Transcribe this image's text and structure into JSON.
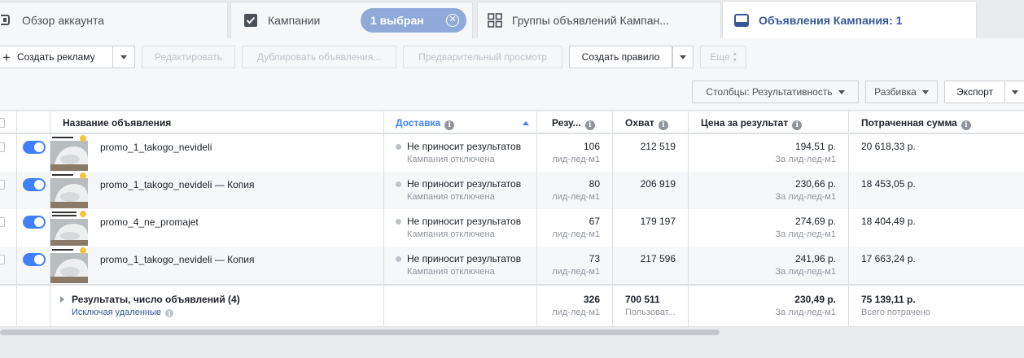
{
  "tabs": {
    "account_overview": "Обзор аккаунта",
    "campaigns": "Кампании",
    "selected_badge": "1 выбран",
    "ad_sets": "Группы объявлений Кампан...",
    "ads": "Объявления Кампания: 1"
  },
  "toolbar": {
    "create_ad": "Создать рекламу",
    "edit": "Редактировать",
    "duplicate": "Дублировать объявления...",
    "preview": "Предварительный просмотр",
    "create_rule": "Создать правило",
    "more": "Еще",
    "columns": "Столбцы: Результативность",
    "breakdown": "Разбивка",
    "export": "Экспорт"
  },
  "table": {
    "headers": {
      "name": "Название объявления",
      "delivery": "Доставка",
      "results": "Резу...",
      "reach": "Охват",
      "cost_per_result": "Цена за результат",
      "amount_spent": "Потраченная сумма"
    },
    "rows": [
      {
        "name": "promo_1_takogo_nevideli",
        "delivery": "Не приносит результатов",
        "delivery_sub": "Кампания отключена",
        "results": "106",
        "results_sub": "лид-лед-м1",
        "reach": "212 519",
        "cost": "194,51 р.",
        "cost_sub": "За лид-лед-м1",
        "spent": "20 618,33 р."
      },
      {
        "name": "promo_1_takogo_nevideli — Копия",
        "delivery": "Не приносит результатов",
        "delivery_sub": "Кампания отключена",
        "results": "80",
        "results_sub": "лид-лед-м1",
        "reach": "206 919",
        "cost": "230,66 р.",
        "cost_sub": "За лид-лед-м1",
        "spent": "18 453,05 р."
      },
      {
        "name": "promo_4_ne_promajet",
        "delivery": "Не приносит результатов",
        "delivery_sub": "Кампания отключена",
        "results": "67",
        "results_sub": "лид-лед-м1",
        "reach": "179 197",
        "cost": "274,69 р.",
        "cost_sub": "За лид-лед-м1",
        "spent": "18 404,49 р."
      },
      {
        "name": "promo_1_takogo_nevideli — Копия",
        "delivery": "Не приносит результатов",
        "delivery_sub": "Кампания отключена",
        "results": "73",
        "results_sub": "лид-лед-м1",
        "reach": "217 596",
        "cost": "241,96 р.",
        "cost_sub": "За лид-лед-м1",
        "spent": "17 663,24 р."
      }
    ],
    "totals": {
      "label": "Результаты, число объявлений (4)",
      "sublabel": "Исключая удаленные",
      "results": "326",
      "results_sub": "лид-лед-м1",
      "reach": "700 511",
      "reach_sub": "Пользоват...",
      "cost": "230,49 р.",
      "cost_sub": "За лид-лед-м1",
      "spent": "75 139,11 р.",
      "spent_sub": "Всего потрачено"
    }
  },
  "colors": {
    "accent": "#4080ff",
    "link": "#365899",
    "badge": "#8faad8"
  }
}
